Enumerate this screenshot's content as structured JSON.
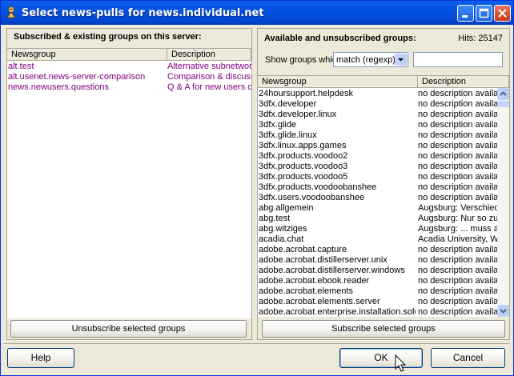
{
  "window": {
    "title": "Select news-pulls for news.individual.net"
  },
  "left_panel": {
    "title": "Subscribed & existing groups on this server:",
    "columns": [
      "Newsgroup",
      "Description"
    ],
    "rows": [
      [
        "alt.test",
        "Alternative subnetwork"
      ],
      [
        "alt.usenet.news-server-comparison",
        "Comparison & discussion"
      ],
      [
        "news.newusers.questions",
        "Q & A for new users of"
      ]
    ],
    "unsubscribe_label": "Unsubscribe selected groups"
  },
  "right_panel": {
    "title": "Available and unsubscribed groups:",
    "hits": "Hits: 25147",
    "show_label": "Show groups which",
    "match_mode": "match (regexp)",
    "filter_value": "",
    "columns": [
      "Newsgroup",
      "Description"
    ],
    "rows": [
      [
        "24hoursupport.helpdesk",
        "no description available"
      ],
      [
        "3dfx.developer",
        "no description available"
      ],
      [
        "3dfx.developer.linux",
        "no description available"
      ],
      [
        "3dfx.glide",
        "no description available"
      ],
      [
        "3dfx.glide.linux",
        "no description available"
      ],
      [
        "3dfx.linux.apps.games",
        "no description available"
      ],
      [
        "3dfx.products.voodoo2",
        "no description available"
      ],
      [
        "3dfx.products.voodoo3",
        "no description available"
      ],
      [
        "3dfx.products.voodoo5",
        "no description available"
      ],
      [
        "3dfx.products.voodoobanshee",
        "no description available"
      ],
      [
        "3dfx.users.voodoobanshee",
        "no description available"
      ],
      [
        "abg.allgemein",
        "Augsburg: Verschiedenes"
      ],
      [
        "abg.test",
        "Augsburg: Nur so zu"
      ],
      [
        "abg.witziges",
        "Augsburg: ... muss a"
      ],
      [
        "acadia.chat",
        "Acadia University, W"
      ],
      [
        "adobe.acrobat.capture",
        "no description available"
      ],
      [
        "adobe.acrobat.distillerserver.unix",
        "no description available"
      ],
      [
        "adobe.acrobat.distillerserver.windows",
        "no description available"
      ],
      [
        "adobe.acrobat.ebook.reader",
        "no description available"
      ],
      [
        "adobe.acrobat.elements",
        "no description available"
      ],
      [
        "adobe.acrobat.elements.server",
        "no description available"
      ],
      [
        "adobe.acrobat.enterprise.installation.solutions",
        "no description available"
      ]
    ],
    "subscribe_label": "Subscribe selected groups"
  },
  "footer": {
    "help_label": "Help",
    "ok_label": "OK",
    "cancel_label": "Cancel"
  },
  "colors": {
    "title_bar": "#0553e0",
    "subscribed_text": "#800080",
    "face": "#ece9d8"
  }
}
